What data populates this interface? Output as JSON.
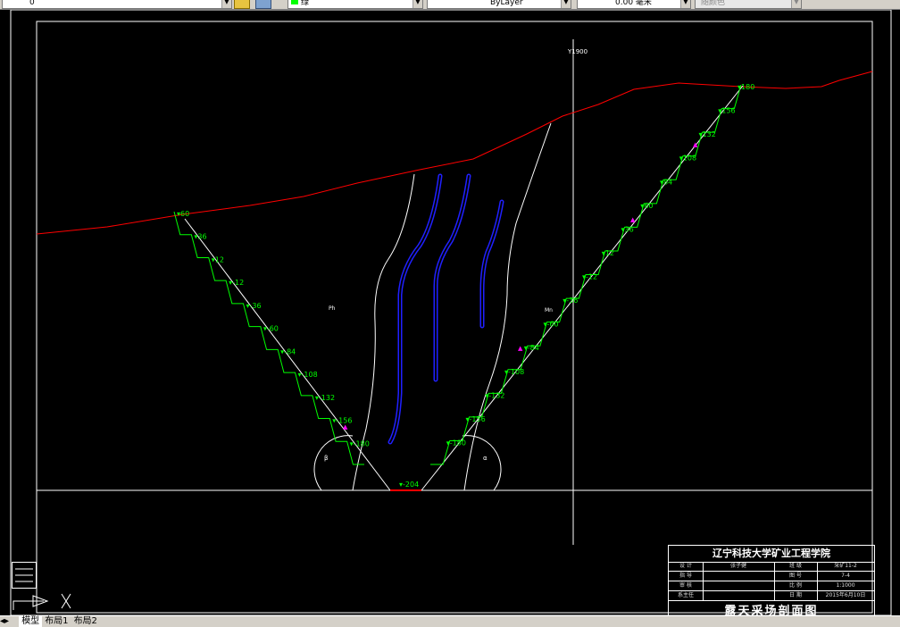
{
  "toolbar": {
    "layer_value": "0",
    "color_value": "绿",
    "linetype_value": "ByLayer",
    "lineweight_value": "0.00 毫米",
    "plotstyle_value": "随颜色"
  },
  "drawing": {
    "center_line_label": "Y1900",
    "left_rock_label": "Ph",
    "right_rock_label": "Mn",
    "left_bench_labels": [
      "60",
      "36",
      "12",
      "-12",
      "-36",
      "-60",
      "-84",
      "-108",
      "-132",
      "-156",
      "-180"
    ],
    "right_bench_labels": [
      "180",
      "156",
      "132",
      "108",
      "84",
      "60",
      "36",
      "12",
      "-12",
      "-36",
      "-60",
      "-84",
      "-108",
      "-132",
      "-156",
      "-180"
    ],
    "bottom_label": "-204",
    "colors": {
      "terrain": "#ff0000",
      "benches": "#00ff00",
      "orebody": "#1a1aff",
      "boundary": "#ffffff",
      "markers": "#ff00ff"
    }
  },
  "title_block": {
    "institute": "辽宁科技大学矿业工程学院",
    "rows": [
      {
        "label1": "设 计",
        "value1": "张子健",
        "label2": "班 级",
        "value2": "采矿11-2"
      },
      {
        "label1": "指 导",
        "value1": "",
        "label2": "图 号",
        "value2": "7-4"
      },
      {
        "label1": "审 核",
        "value1": "",
        "label2": "比 例",
        "value2": "1:1000"
      },
      {
        "label1": "系主任",
        "value1": "",
        "label2": "日 期",
        "value2": "2015年6月10日"
      }
    ],
    "drawing_title": "露天采场剖面图"
  },
  "statusbar": {
    "tabs": [
      "模型",
      "布局1",
      "布局2"
    ]
  }
}
